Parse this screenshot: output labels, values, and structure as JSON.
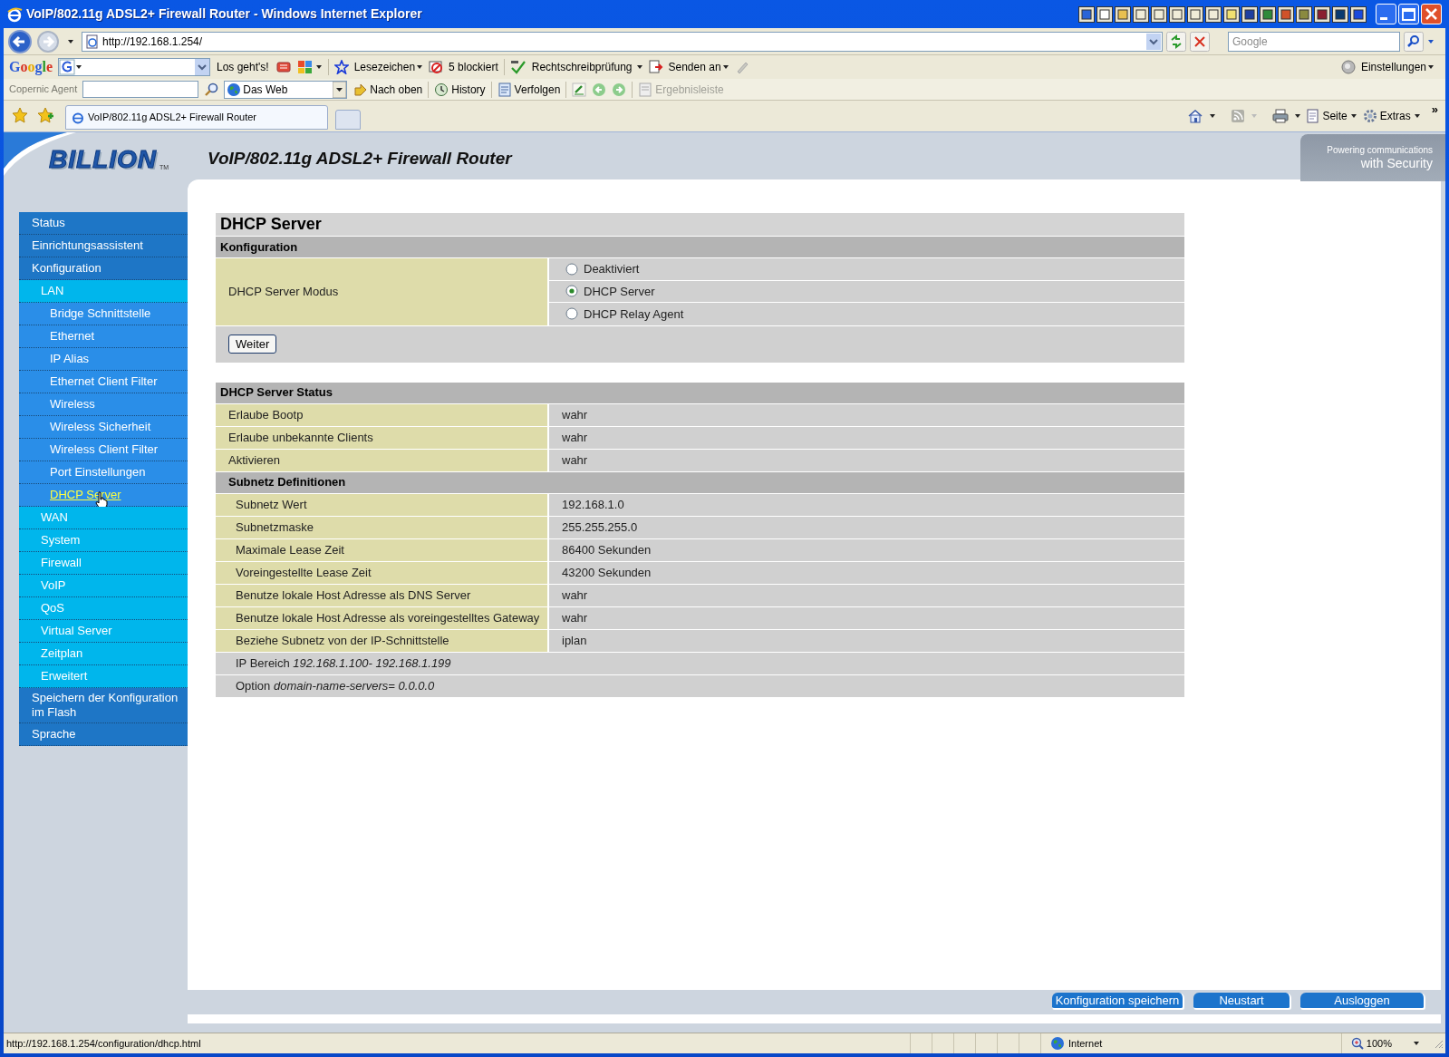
{
  "window": {
    "title": "VoIP/802.11g ADSL2+ Firewall Router - Windows Internet Explorer"
  },
  "address_bar": {
    "url": "http://192.168.1.254/",
    "search_placeholder": "Google"
  },
  "google_toolbar": {
    "logo": "Google",
    "search_button": "Los geht's!",
    "bookmarks": "Lesezeichen",
    "blocked": "5 blockiert",
    "spellcheck": "Rechtschreibprüfung",
    "send": "Senden an",
    "settings": "Einstellungen"
  },
  "copernic_toolbar": {
    "label": "Copernic Agent",
    "scope": "Das Web",
    "buttons": [
      {
        "label": "Nach oben",
        "disabled": false
      },
      {
        "label": "History",
        "disabled": false
      },
      {
        "label": "Verfolgen",
        "disabled": false
      },
      {
        "label": "Ergebnisleiste",
        "disabled": true
      }
    ]
  },
  "tabs": [
    {
      "label": "VoIP/802.11g ADSL2+ Firewall Router",
      "selected": true
    }
  ],
  "command_bar": {
    "page": "Seite",
    "tools": "Extras",
    "more": "»"
  },
  "header": {
    "logo": "BILLION",
    "trademark": "TM",
    "title": "VoIP/802.11g ADSL2+ Firewall Router",
    "tagline": [
      "Powering communications",
      "with Security"
    ]
  },
  "sidebar": {
    "items": [
      {
        "label": "Status",
        "selected": false
      },
      {
        "label": "Einrichtungsassistent",
        "selected": false
      },
      {
        "label": "Konfiguration",
        "selected": false,
        "children": [
          {
            "label": "LAN",
            "selected": false,
            "children": [
              {
                "label": "Bridge Schnittstelle",
                "selected": false
              },
              {
                "label": "Ethernet",
                "selected": false
              },
              {
                "label": "IP Alias",
                "selected": false
              },
              {
                "label": "Ethernet Client Filter",
                "selected": false
              },
              {
                "label": "Wireless",
                "selected": false
              },
              {
                "label": "Wireless Sicherheit",
                "selected": false
              },
              {
                "label": "Wireless Client Filter",
                "selected": false
              },
              {
                "label": "Port Einstellungen",
                "selected": false
              },
              {
                "label": "DHCP Server",
                "selected": true
              }
            ]
          },
          {
            "label": "WAN",
            "selected": false
          },
          {
            "label": "System",
            "selected": false
          },
          {
            "label": "Firewall",
            "selected": false
          },
          {
            "label": "VoIP",
            "selected": false
          },
          {
            "label": "QoS",
            "selected": false
          },
          {
            "label": "Virtual Server",
            "selected": false
          },
          {
            "label": "Zeitplan",
            "selected": false
          },
          {
            "label": "Erweitert",
            "selected": false
          }
        ]
      },
      {
        "label": "Speichern der Konfiguration im Flash",
        "selected": false
      },
      {
        "label": "Sprache",
        "selected": false
      }
    ]
  },
  "content": {
    "title": "DHCP Server",
    "config": {
      "heading": "Konfiguration",
      "mode": {
        "label": "DHCP Server Modus",
        "options": [
          {
            "label": "Deaktiviert",
            "selected": false
          },
          {
            "label": "DHCP Server",
            "selected": true
          },
          {
            "label": "DHCP Relay Agent",
            "selected": false
          }
        ]
      },
      "button": "Weiter"
    },
    "status": {
      "heading": "DHCP Server Status",
      "rows": [
        {
          "kind": "pair",
          "label": "Erlaube Bootp",
          "value": "wahr"
        },
        {
          "kind": "pair",
          "label": "Erlaube unbekannte Clients",
          "value": "wahr"
        },
        {
          "kind": "pair",
          "label": "Aktivieren",
          "value": "wahr"
        },
        {
          "kind": "group",
          "label": "Subnetz Definitionen",
          "rows": [
            {
              "kind": "pair",
              "label": "Subnetz Wert",
              "value": "192.168.1.0"
            },
            {
              "kind": "pair",
              "label": "Subnetzmaske",
              "value": "255.255.255.0"
            },
            {
              "kind": "pair",
              "label": "Maximale Lease Zeit",
              "value": "86400 Sekunden"
            },
            {
              "kind": "pair",
              "label": "Voreingestellte Lease Zeit",
              "value": "43200 Sekunden"
            },
            {
              "kind": "pair",
              "label": "Benutze lokale Host Adresse als DNS Server",
              "value": "wahr"
            },
            {
              "kind": "pair",
              "label": "Benutze lokale Host Adresse als voreingestelltes Gateway",
              "value": "wahr"
            },
            {
              "kind": "pair",
              "label": "Beziehe Subnetz von der IP-Schnittstelle",
              "value": "iplan"
            },
            {
              "kind": "note",
              "text": "IP Bereich *192.168.1.100- 192.168.1.199*"
            },
            {
              "kind": "note",
              "text": "Option *domain-name-servers= 0.0.0.0*"
            }
          ]
        }
      ]
    }
  },
  "footer_buttons": [
    "Konfiguration speichern",
    "Neustart",
    "Ausloggen"
  ],
  "status_bar": {
    "url": "http://192.168.1.254/configuration/dhcp.html",
    "zone": "Internet",
    "zoom": "100%"
  }
}
